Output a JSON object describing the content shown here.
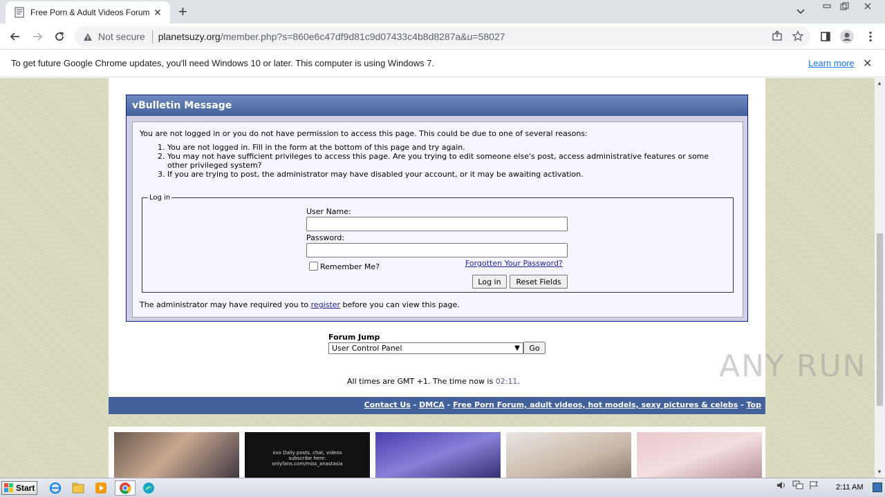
{
  "browser": {
    "tab_title": "Free Porn & Adult Videos Forum",
    "tab_close": "✕",
    "new_tab": "+",
    "not_secure": "Not secure",
    "url_host": "planetsuzy.org",
    "url_path": "/member.php?s=860e6c47df9d81c9d07433c4b8d8287a&u=58027"
  },
  "infobar": {
    "message": "To get future Google Chrome updates, you'll need Windows 10 or later. This computer is using Windows 7.",
    "learn_more": "Learn more",
    "close": "✕"
  },
  "message_panel": {
    "title": "vBulletin Message",
    "intro": "You are not logged in or you do not have permission to access this page. This could be due to one of several reasons:",
    "reasons": [
      "You are not logged in. Fill in the form at the bottom of this page and try again.",
      "You may not have sufficient privileges to access this page. Are you trying to edit someone else's post, access administrative features or some other privileged system?",
      "If you are trying to post, the administrator may have disabled your account, or it may be awaiting activation."
    ],
    "login": {
      "legend": "Log in",
      "username_label": "User Name:",
      "password_label": "Password:",
      "remember_label": "Remember Me?",
      "forgot_link": "Forgotten Your Password?",
      "login_button": "Log in",
      "reset_button": "Reset Fields"
    },
    "footnote_before": "The administrator may have required you to ",
    "footnote_link": "register",
    "footnote_after": " before you can view this page."
  },
  "forum_jump": {
    "label": "Forum Jump",
    "selected": "User Control Panel",
    "go": "Go"
  },
  "times": {
    "prefix": "All times are GMT +1. The time now is ",
    "time": "02:11",
    "suffix": "."
  },
  "footer_links": {
    "contact": "Contact Us",
    "dmca": "DMCA",
    "home": "Free Porn Forum, adult videos, hot models, sexy pictures & celebs",
    "top": "Top",
    "separator": " - "
  },
  "thumbnail_text": "xxx Daily posts, chat, videos subscribe here: onlyfans.com/miss_anastasia",
  "watermark": "ANY RUN",
  "taskbar": {
    "start": "Start",
    "clock": "2:11 AM"
  },
  "colors": {
    "panel_header": "#43619a",
    "footer_bar": "#43619a",
    "page_background": "#dcdcc0",
    "link": "#22229c"
  }
}
